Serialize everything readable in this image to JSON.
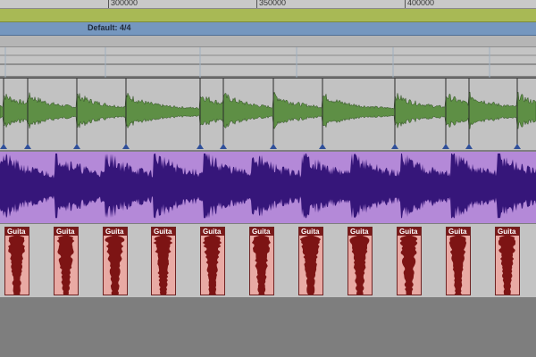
{
  "ruler": {
    "labels": [
      "300000",
      "350000",
      "400000"
    ]
  },
  "tempo_ruler": {
    "meter_label": "Default: 4/4"
  },
  "tracks": {
    "audio_track_green": {
      "color": "#5e8f45"
    },
    "audio_track_purple": {
      "color": "#36167a"
    },
    "guitar_track": {
      "clip_name": "Guita",
      "clip_count": 11,
      "color": "#7d1414"
    }
  },
  "colors": {
    "marker_triangle": "#2f4f9a",
    "meter_bar": "#7597bf",
    "top_bar": "#a8b955"
  }
}
